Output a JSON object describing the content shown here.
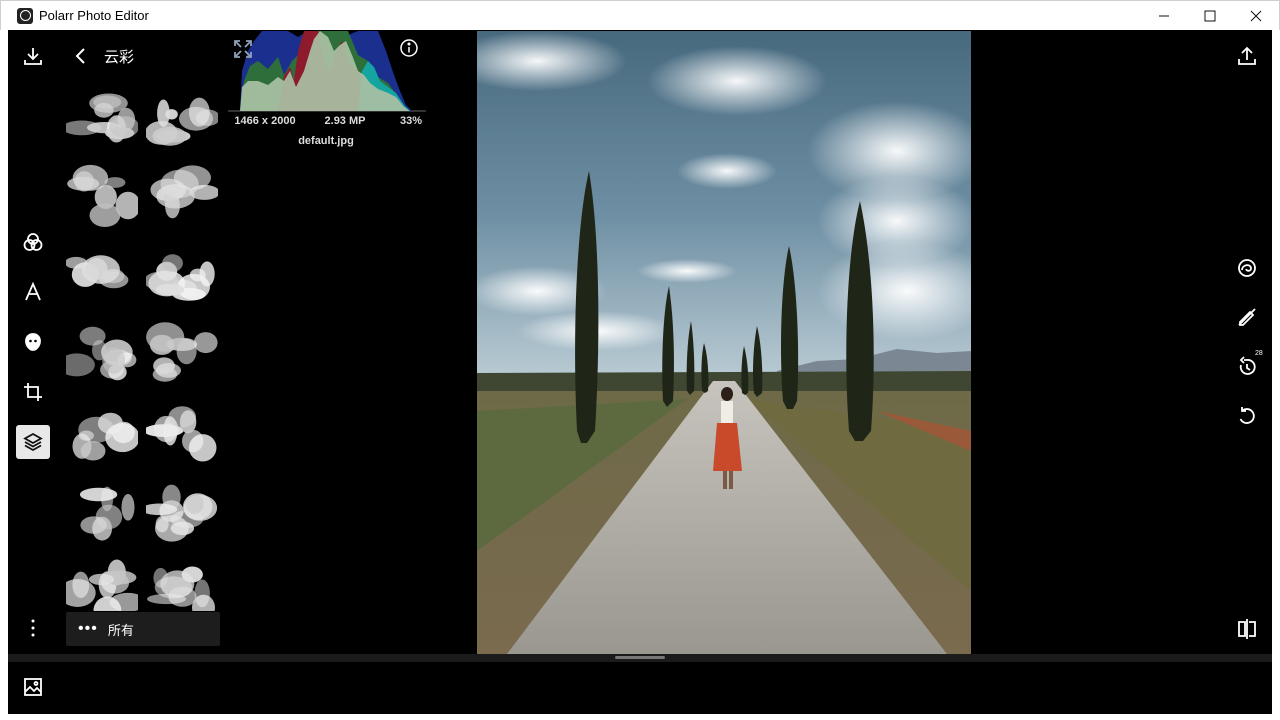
{
  "window": {
    "title": "Polarr Photo Editor"
  },
  "panel": {
    "title": "云彩",
    "filter_label": "所有",
    "thumbnails": 14
  },
  "image_info": {
    "dimensions": "1466 x 2000",
    "megapixels": "2.93 MP",
    "zoom": "33%",
    "filename": "default.jpg"
  },
  "right_rail": {
    "history_badge": "28"
  },
  "icons": {
    "rail": [
      "download-icon",
      "color-filter-icon",
      "text-icon",
      "face-icon",
      "crop-icon",
      "layers-icon",
      "more-vertical-icon"
    ],
    "right": [
      "export-icon",
      "swirl-icon",
      "no-edit-icon",
      "history-icon",
      "undo-icon",
      "compare-icon"
    ],
    "bottom": [
      "image-icon"
    ]
  },
  "colors": {
    "background": "#000000",
    "titlebar": "#ffffff",
    "panel_bar": "#1d1d1d",
    "active_tool": "#e8e8e8"
  }
}
